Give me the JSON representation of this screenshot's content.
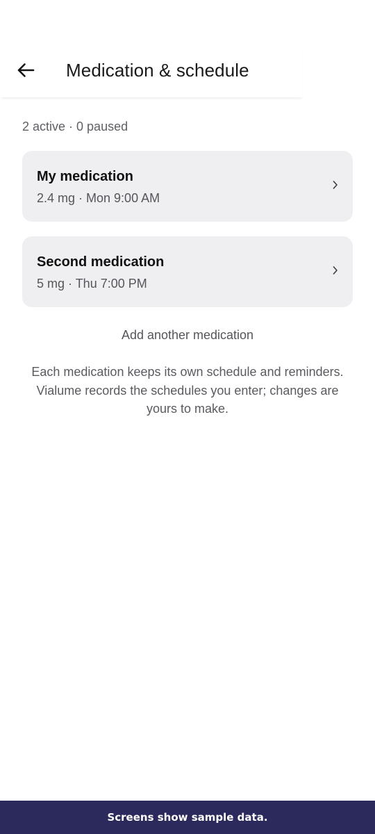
{
  "header": {
    "title": "Medication & schedule",
    "back_icon": "arrow-left-icon"
  },
  "summary": {
    "text": "2 active · 0 paused"
  },
  "medications": [
    {
      "name": "My medication",
      "detail": "2.4 mg · Mon 9:00 AM",
      "icon": "chevron-right-icon"
    },
    {
      "name": "Second medication",
      "detail": "5 mg · Thu 7:00 PM",
      "icon": "chevron-right-icon"
    }
  ],
  "actions": {
    "add_label": "Add another medication"
  },
  "info": {
    "text": "Each medication keeps its own schedule and reminders. Vialume records the schedules you enter; changes are yours to make."
  },
  "footer": {
    "text": "Screens show sample data."
  },
  "colors": {
    "card_bg": "#efeff1",
    "footer_bg": "#2c2a5c",
    "secondary_text": "#55555b"
  }
}
